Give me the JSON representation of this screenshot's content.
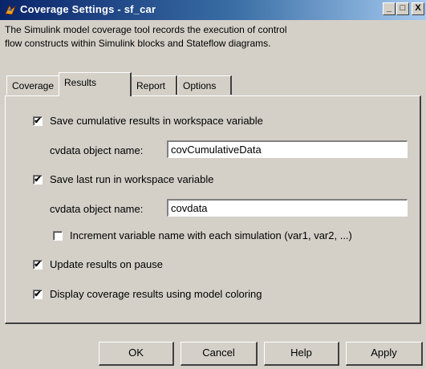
{
  "window": {
    "title": "Coverage Settings - sf_car",
    "minimize_glyph": "_",
    "maximize_glyph": "□",
    "close_glyph": "X"
  },
  "description": {
    "line1": "The Simulink model coverage tool records the execution of control",
    "line2": "flow constructs within Simulink blocks and Stateflow diagrams."
  },
  "tabs": [
    {
      "label": "Coverage"
    },
    {
      "label": "Results"
    },
    {
      "label": "Report"
    },
    {
      "label": "Options"
    }
  ],
  "results": {
    "save_cumulative": {
      "label": "Save cumulative results in workspace variable",
      "checked": true
    },
    "cumulative_name_label": "cvdata object name:",
    "cumulative_name_value": "covCumulativeData",
    "save_last_run": {
      "label": "Save last run in workspace variable",
      "checked": true
    },
    "last_run_name_label": "cvdata object name:",
    "last_run_name_value": "covdata",
    "increment_name": {
      "label": "Increment variable name with each simulation (var1, var2, ...)",
      "checked": false
    },
    "update_on_pause": {
      "label": "Update results on pause",
      "checked": true
    },
    "model_coloring": {
      "label": "Display coverage results using model coloring",
      "checked": true
    }
  },
  "buttons": {
    "ok": "OK",
    "cancel": "Cancel",
    "help": "Help",
    "apply": "Apply"
  },
  "icons": {
    "title_icon": "simulink-block-icon",
    "check_glyph": "✔"
  },
  "colors": {
    "titlebar_start": "#0a246a",
    "titlebar_end": "#a6caf0",
    "dialog_bg": "#d4d0c8"
  }
}
